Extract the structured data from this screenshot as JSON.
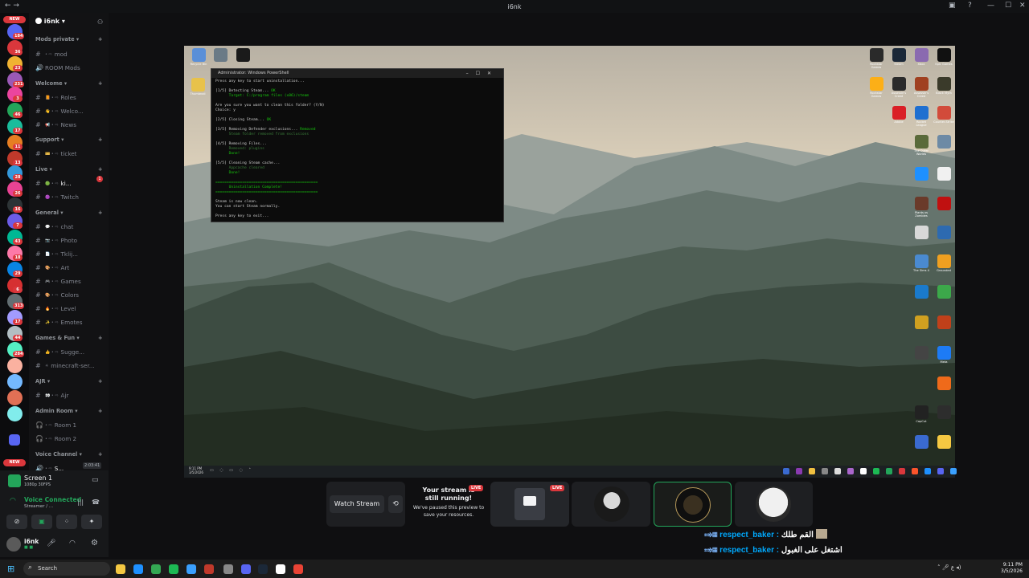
{
  "window": {
    "title": "i6nk"
  },
  "rail": {
    "badges": [
      "184",
      "36",
      "23",
      "231",
      "3",
      "46",
      "17",
      "11",
      "13",
      "28",
      "26",
      "16",
      "7",
      "43",
      "18",
      "29",
      "6",
      "313",
      "17",
      "44",
      "284"
    ],
    "new_label": "NEW"
  },
  "server": {
    "name": "i6nk"
  },
  "channels": {
    "mods_private": {
      "label": "Mods private",
      "items": [
        "mod",
        "ROOM Mods"
      ]
    },
    "welcome": {
      "label": "Welcome",
      "items": [
        "Roles",
        "Welco...",
        "News"
      ]
    },
    "support": {
      "label": "Support",
      "items": [
        "ticket"
      ]
    },
    "live": {
      "label": "Live",
      "items": [
        "ki...",
        "Twitch"
      ],
      "badge": "1"
    },
    "general": {
      "label": "General",
      "items": [
        "chat",
        "Photo",
        "Tklij...",
        "Art",
        "Games",
        "Colors",
        "Level",
        "Emotes"
      ]
    },
    "games_fun": {
      "label": "Games & Fun",
      "items": [
        "Sugge...",
        "minecraft-ser..."
      ]
    },
    "ajr": {
      "label": "AJR",
      "items": [
        "Ajr"
      ]
    },
    "admin_room": {
      "label": "Admin Room",
      "items": [
        "Room 1",
        "Room 2"
      ]
    },
    "voice_channel": {
      "label": "Voice Channel",
      "items": [
        "S..."
      ],
      "timer": "2:03:41"
    }
  },
  "user_panel": {
    "screen_title": "Screen 1",
    "screen_sub": "1080p 30FPS",
    "voice_status": "Voice Connected",
    "voice_sub": "Streamer / ...",
    "username": "i6nk"
  },
  "powershell": {
    "title": "Administrator: Windows PowerShell",
    "lines": [
      {
        "t": "Press any key to start uninstallation...",
        "c": ""
      },
      {
        "t": "",
        "c": ""
      },
      {
        "t": "[1/5] Detecting Steam... ",
        "c": "",
        "s": "OK"
      },
      {
        "t": "      Target: C:/program files (x86)/steam",
        "c": "g"
      },
      {
        "t": "",
        "c": ""
      },
      {
        "t": "Are you sure you want to clean this folder? (Y/N)",
        "c": ""
      },
      {
        "t": "Choice: y",
        "c": ""
      },
      {
        "t": "",
        "c": ""
      },
      {
        "t": "[2/5] Closing Steam... ",
        "c": "",
        "s": "OK"
      },
      {
        "t": "",
        "c": ""
      },
      {
        "t": "[3/5] Removing Defender exclusions... ",
        "c": "",
        "s": "Removed"
      },
      {
        "t": "      Steam folder removed from exclusions",
        "c": "gd"
      },
      {
        "t": "",
        "c": ""
      },
      {
        "t": "[4/5] Removing Files...",
        "c": ""
      },
      {
        "t": "      Removed: plugins",
        "c": "gd"
      },
      {
        "t": "      Done!",
        "c": "g"
      },
      {
        "t": "",
        "c": ""
      },
      {
        "t": "[5/5] Cleaning Steam cache...",
        "c": ""
      },
      {
        "t": "      Appcache cleared",
        "c": "gd"
      },
      {
        "t": "      Done!",
        "c": "g"
      },
      {
        "t": "",
        "c": ""
      },
      {
        "t": "==============================================",
        "c": "g"
      },
      {
        "t": "      Uninstallation Complete!",
        "c": "g"
      },
      {
        "t": "==============================================",
        "c": "g"
      },
      {
        "t": "",
        "c": ""
      },
      {
        "t": "Steam is now clean.",
        "c": ""
      },
      {
        "t": "You can start Steam normally.",
        "c": ""
      },
      {
        "t": "",
        "c": ""
      },
      {
        "t": "Press any key to exit...",
        "c": ""
      }
    ]
  },
  "desktop_icons_left": [
    {
      "label": "Recycle Bin",
      "color": "#5a8fd8"
    },
    {
      "label": "",
      "color": "#6a7a86"
    },
    {
      "label": "",
      "color": "#1a1a1a"
    },
    {
      "label": "Thumbnail",
      "color": "#e8c24a"
    }
  ],
  "desktop_icons_right": [
    {
      "label": "Rockstar Games",
      "color": "#2a2a2a"
    },
    {
      "label": "Steam",
      "color": "#1b2838"
    },
    {
      "label": "Xbox",
      "color": "#8a6ab0"
    },
    {
      "label": "Epic Games",
      "color": "#111"
    },
    {
      "label": "Rockstar Games",
      "color": "#fcaf17"
    },
    {
      "label": "Assassin's Creed",
      "color": "#2b2b2b"
    },
    {
      "label": "Assassin's Creed",
      "color": "#a04020"
    },
    {
      "label": "Black Myth",
      "color": "#3a3a2a"
    },
    {
      "label": "Adobe",
      "color": "#da1f26"
    },
    {
      "label": "Rocket League",
      "color": "#1f6fd0"
    },
    {
      "label": "Counter-Strike",
      "color": "#d24b3a"
    },
    {
      "label": "The Outer Worlds",
      "color": "#5a6a3a"
    },
    {
      "label": "",
      "color": "#6d8aa5"
    },
    {
      "label": "",
      "color": "#1e90ff"
    },
    {
      "label": "",
      "color": "#f0f0f0"
    },
    {
      "label": "Plants vs Zombies",
      "color": "#6a3a2a"
    },
    {
      "label": "",
      "color": "#c01010"
    },
    {
      "label": "",
      "color": "#d8d8d8"
    },
    {
      "label": "",
      "color": "#2d6ab0"
    },
    {
      "label": "The Sims 4",
      "color": "#4a8ad0"
    },
    {
      "label": "Grounded",
      "color": "#f0a020"
    },
    {
      "label": "",
      "color": "#1a7acc"
    },
    {
      "label": "",
      "color": "#3ca84a"
    },
    {
      "label": "",
      "color": "#d0a020"
    },
    {
      "label": "",
      "color": "#c0401a"
    },
    {
      "label": "",
      "color": "#444"
    },
    {
      "label": "Meta",
      "color": "#1d7bf5"
    },
    {
      "label": "",
      "color": "#ef6a1a"
    },
    {
      "label": "CapCut",
      "color": "#222"
    },
    {
      "label": "",
      "color": "#2d2d2d"
    },
    {
      "label": "",
      "color": "#3a6ad0"
    },
    {
      "label": "",
      "color": "#f5c842"
    }
  ],
  "stream_taskbar": {
    "time": "9:11 PM",
    "date": "3/5/2026"
  },
  "stream_controls": {
    "watch_button": "Watch Stream",
    "paused_title": "Your stream is still running!",
    "paused_body": "We've paused this preview to save your resources.",
    "live_badge": "LIVE"
  },
  "chat": [
    {
      "user": "respect_baker",
      "message": "القم طلك"
    },
    {
      "user": "respect_baker",
      "message": "اشتغل على الغبول"
    }
  ],
  "taskbar": {
    "search_placeholder": "Search",
    "time": "9:11 PM",
    "date": "3/5/2026"
  }
}
